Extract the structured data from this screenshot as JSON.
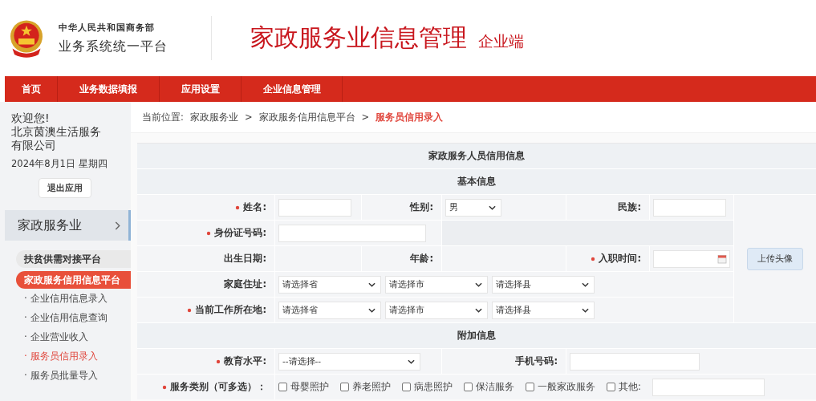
{
  "header": {
    "org_line1": "中华人民共和国商务部",
    "org_line2": "业务系统统一平台",
    "title": "家政服务业信息管理",
    "subtitle": "企业端"
  },
  "nav": [
    {
      "label": "首页"
    },
    {
      "label": "业务数据填报"
    },
    {
      "label": "应用设置"
    },
    {
      "label": "企业信息管理"
    }
  ],
  "sidebar": {
    "welcome": "欢迎您!",
    "company": "北京茵澳生活服务有限公司",
    "date": "2024年8月1日 星期四",
    "logout_button": "退出应用",
    "section": "家政服务业",
    "groups": [
      {
        "label": "扶贫供需对接平台",
        "selected": false
      },
      {
        "label": "家政服务信用信息平台",
        "selected": true
      }
    ],
    "links": [
      {
        "label": "· 企业信用信息录入",
        "selected": false
      },
      {
        "label": "· 企业信用信息查询",
        "selected": false
      },
      {
        "label": "· 企业营业收入",
        "selected": false
      },
      {
        "label": "· 服务员信用录入",
        "selected": true
      },
      {
        "label": "· 服务员批量导入",
        "selected": false
      }
    ]
  },
  "breadcrumb": [
    {
      "text": "当前位置:",
      "kind": "prefix"
    },
    {
      "text": "家政服务业",
      "kind": "link"
    },
    {
      "text": ">",
      "kind": "sep"
    },
    {
      "text": "家政服务信用信息平台",
      "kind": "link"
    },
    {
      "text": ">",
      "kind": "sep"
    },
    {
      "text": "服务员信用录入",
      "kind": "current"
    }
  ],
  "form": {
    "title": "家政服务人员信用信息",
    "basic_heading": "基本信息",
    "name": {
      "label": "姓名:",
      "required": true
    },
    "gender": {
      "label": "性别:",
      "required": false,
      "value": "男"
    },
    "ethnicity": {
      "label": "民族:",
      "required": false
    },
    "id_number": {
      "label": "身份证号码:",
      "required": true
    },
    "birth_date": {
      "label": "出生日期:",
      "required": false
    },
    "age": {
      "label": "年龄:",
      "required": false
    },
    "hire_date": {
      "label": "入职时间:",
      "required": true
    },
    "home_address": {
      "label": "家庭住址:",
      "required": false,
      "selects": [
        "请选择省",
        "请选择市",
        "请选择县"
      ]
    },
    "work_location": {
      "label": "当前工作所在地:",
      "required": true,
      "selects": [
        "请选择省",
        "请选择市",
        "请选择县"
      ]
    },
    "upload_button": "上传头像",
    "extra_heading": "附加信息",
    "education": {
      "label": "教育水平:",
      "required": true,
      "value": "--请选择--"
    },
    "phone": {
      "label": "手机号码:",
      "required": false
    },
    "service_type": {
      "label": "服务类别（可多选）：",
      "required": true,
      "options": [
        {
          "label": "母婴照护",
          "checked": false
        },
        {
          "label": "养老照护",
          "checked": false
        },
        {
          "label": "病患照护",
          "checked": false
        },
        {
          "label": "保洁服务",
          "checked": false
        },
        {
          "label": "一般家政服务",
          "checked": false
        }
      ],
      "other_label": "其他:",
      "other_checked": false
    }
  }
}
